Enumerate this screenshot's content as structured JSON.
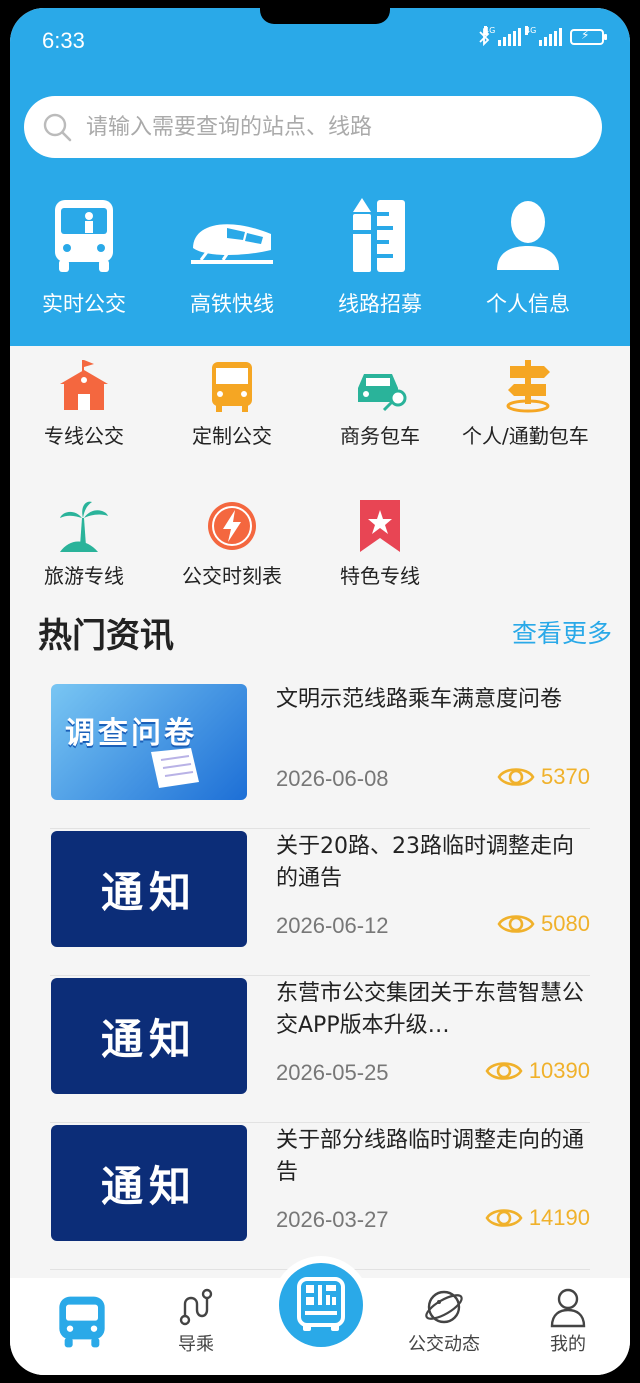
{
  "status_bar": {
    "time": "6:33",
    "network_1": "4G",
    "network_2": "4G"
  },
  "search": {
    "placeholder": "请输入需要查询的站点、线路"
  },
  "top_nav": [
    {
      "label": "实时公交",
      "icon": "bus-front-icon"
    },
    {
      "label": "高铁快线",
      "icon": "high-speed-train-icon"
    },
    {
      "label": "线路招募",
      "icon": "pencil-ruler-icon"
    },
    {
      "label": "个人信息",
      "icon": "person-icon"
    }
  ],
  "services": [
    {
      "label": "专线公交",
      "icon": "school-building-icon",
      "color": "#f4673f"
    },
    {
      "label": "定制公交",
      "icon": "bus-icon",
      "color": "#f5a623"
    },
    {
      "label": "商务包车",
      "icon": "car-key-icon",
      "color": "#2ab39a"
    },
    {
      "label": "个人/通勤包车",
      "icon": "signpost-icon",
      "color": "#f5a623"
    },
    {
      "label": "旅游专线",
      "icon": "palm-tree-icon",
      "color": "#2ab39a"
    },
    {
      "label": "公交时刻表",
      "icon": "clock-lightning-icon",
      "color": "#f4673f"
    },
    {
      "label": "特色专线",
      "icon": "star-bookmark-icon",
      "color": "#e84554"
    }
  ],
  "hot_news": {
    "title": "热门资讯",
    "more_label": "查看更多",
    "items": [
      {
        "title": "文明示范线路乘车满意度问卷",
        "date": "2026-06-08",
        "views": "5370",
        "thumb_text": "调查问卷",
        "thumb_type": "survey"
      },
      {
        "title": "关于20路、23路临时调整走向的通告",
        "date": "2026-06-12",
        "views": "5080",
        "thumb_text": "通知",
        "thumb_type": "notice"
      },
      {
        "title": "东营市公交集团关于东营智慧公交APP版本升级…",
        "date": "2026-05-25",
        "views": "10390",
        "thumb_text": "通知",
        "thumb_type": "notice"
      },
      {
        "title": "关于部分线路临时调整走向的通告",
        "date": "2026-03-27",
        "views": "14190",
        "thumb_text": "通知",
        "thumb_type": "notice"
      }
    ]
  },
  "tab_bar": [
    {
      "label": "",
      "icon": "bus-tab-icon",
      "active": true
    },
    {
      "label": "导乘",
      "icon": "route-icon"
    },
    {
      "label": "",
      "icon": "qr-bus-icon"
    },
    {
      "label": "公交动态",
      "icon": "planet-icon"
    },
    {
      "label": "我的",
      "icon": "user-icon"
    }
  ],
  "colors": {
    "primary": "#2aa9e8",
    "view_count": "#f0b12b",
    "notice_bg": "#0c2d78"
  }
}
